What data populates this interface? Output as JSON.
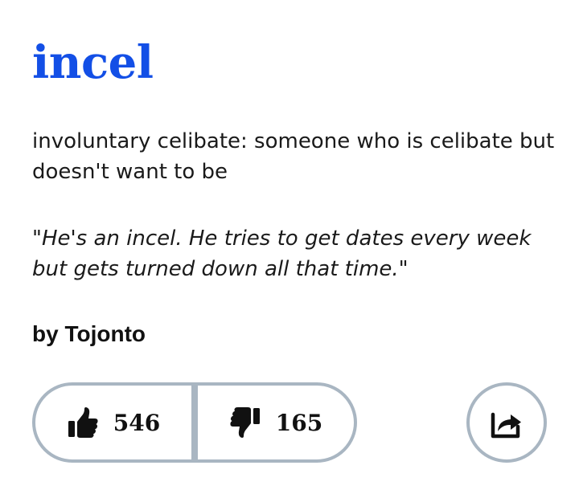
{
  "entry": {
    "word": "incel",
    "meaning": "involuntary celibate: someone who is celibate but doesn't want to be",
    "example": "\"He's an incel. He tries to get dates every week but gets turned down all that time.\"",
    "author": "by Tojonto"
  },
  "votes": {
    "up_count": "546",
    "down_count": "165",
    "up_icon": "thumbs-up-icon",
    "down_icon": "thumbs-down-icon"
  },
  "share": {
    "icon": "share-icon"
  },
  "colors": {
    "word": "#134fe6",
    "button_border": "#a9b6c2",
    "text": "#1a1a1a"
  }
}
